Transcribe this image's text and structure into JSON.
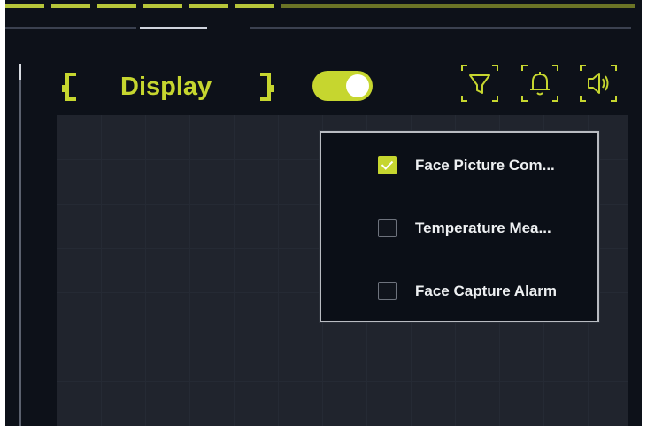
{
  "header": {
    "title": "Display",
    "display_toggle": {
      "state": "on"
    },
    "icons": {
      "filter": "filter-icon",
      "bell": "bell-icon",
      "sound": "speaker-icon"
    }
  },
  "dropdown": {
    "options": [
      {
        "label": "Face Picture Com...",
        "checked": true
      },
      {
        "label": "Temperature Mea...",
        "checked": false
      },
      {
        "label": "Face Capture Alarm",
        "checked": false
      }
    ]
  },
  "colors": {
    "accent": "#c6d62f",
    "background": "#0d1119",
    "panel": "#20242d",
    "dropdown_border": "#b9bcc2"
  }
}
